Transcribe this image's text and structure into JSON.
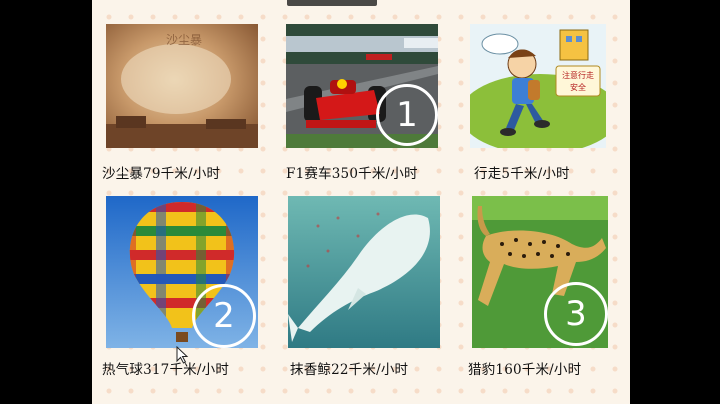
{
  "slide": {
    "cards": [
      {
        "caption": "沙尘暴79千米/小时",
        "image": "sandstorm-photo"
      },
      {
        "caption": "F1赛车350千米/小时",
        "image": "f1-race-car-photo",
        "marker": "1"
      },
      {
        "caption": "行走5千米/小时",
        "image": "walking-boy-cartoon",
        "sign_text": "注意行走安全"
      },
      {
        "caption": "热气球317千米/小时",
        "image": "hot-air-balloon-photo",
        "marker": "2"
      },
      {
        "caption": "抹香鲸22千米/小时",
        "image": "sperm-whale-photo"
      },
      {
        "caption": "猎豹160千米/小时",
        "image": "cheetah-photo",
        "marker": "3"
      }
    ]
  },
  "colors": {
    "slide_bg": "#fbf4ea",
    "dot": "#f6dcc8",
    "marker": "#ffffff"
  },
  "icons": {
    "cursor": "mouse-pointer-icon"
  }
}
